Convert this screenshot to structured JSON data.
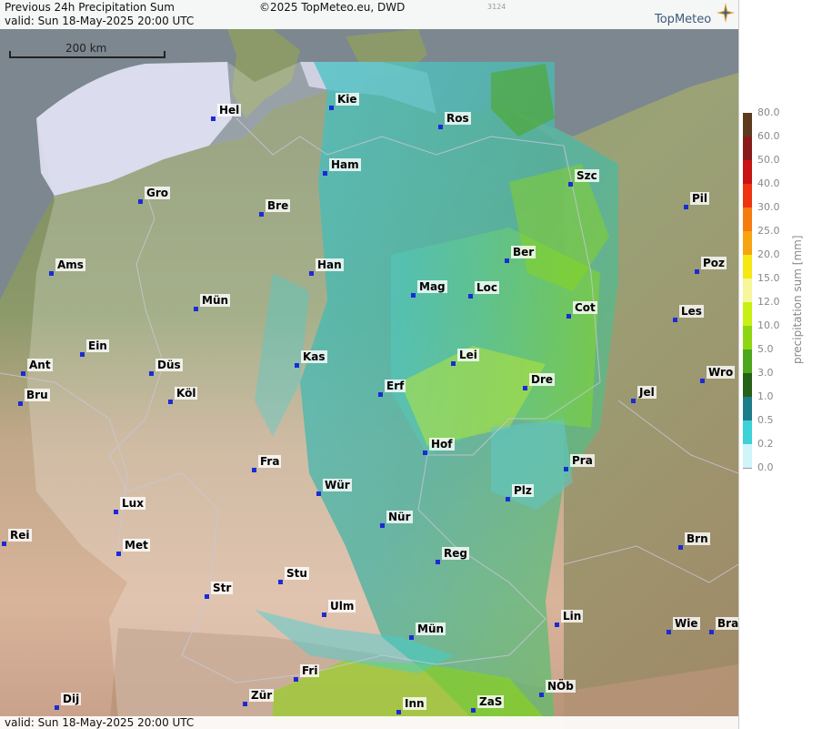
{
  "header": {
    "title": "Previous 24h Precipitation Sum",
    "valid": "valid:  Sun  18-May-2025 20:00 UTC",
    "copyright": "©2025 TopMeteo.eu, DWD",
    "code": "3124",
    "logo": "TopMeteo"
  },
  "footer": {
    "valid": "valid:  Sun  18-May-2025 20:00 UTC"
  },
  "scale_bar": {
    "label": "200 km"
  },
  "legend": {
    "title": "precipitation sum [mm]",
    "steps": [
      {
        "value": "80.0",
        "color": "#5c3a1e"
      },
      {
        "value": "60.0",
        "color": "#8a1a1a"
      },
      {
        "value": "50.0",
        "color": "#c81414"
      },
      {
        "value": "40.0",
        "color": "#ee3410"
      },
      {
        "value": "30.0",
        "color": "#f57c10"
      },
      {
        "value": "25.0",
        "color": "#f7a410"
      },
      {
        "value": "20.0",
        "color": "#f6e812"
      },
      {
        "value": "15.0",
        "color": "#f6f69a"
      },
      {
        "value": "12.0",
        "color": "#c8f012"
      },
      {
        "value": "10.0",
        "color": "#8ed612"
      },
      {
        "value": "5.0",
        "color": "#4ca81a"
      },
      {
        "value": "3.0",
        "color": "#236218"
      },
      {
        "value": "1.0",
        "color": "#1e7d8a"
      },
      {
        "value": "0.5",
        "color": "#3dd1d8"
      },
      {
        "value": "0.2",
        "color": "#cff4fa"
      },
      {
        "value": "0.0",
        "color": "#ffffff"
      }
    ]
  },
  "cities": [
    {
      "name": "Hel",
      "id": "hel"
    },
    {
      "name": "Kie",
      "id": "kie"
    },
    {
      "name": "Ros",
      "id": "ros"
    },
    {
      "name": "Ham",
      "id": "ham"
    },
    {
      "name": "Szc",
      "id": "szc"
    },
    {
      "name": "Gro",
      "id": "gro"
    },
    {
      "name": "Bre",
      "id": "bre"
    },
    {
      "name": "Pil",
      "id": "pil"
    },
    {
      "name": "Ber",
      "id": "ber"
    },
    {
      "name": "Ams",
      "id": "ams"
    },
    {
      "name": "Han",
      "id": "han"
    },
    {
      "name": "Poz",
      "id": "poz"
    },
    {
      "name": "Mag",
      "id": "mag"
    },
    {
      "name": "Loc",
      "id": "loc"
    },
    {
      "name": "Mün",
      "id": "mun-w"
    },
    {
      "name": "Cot",
      "id": "cot"
    },
    {
      "name": "Les",
      "id": "les"
    },
    {
      "name": "Ein",
      "id": "ein"
    },
    {
      "name": "Kas",
      "id": "kas"
    },
    {
      "name": "Lei",
      "id": "lei"
    },
    {
      "name": "Ant",
      "id": "ant"
    },
    {
      "name": "Düs",
      "id": "dus"
    },
    {
      "name": "Dre",
      "id": "dre"
    },
    {
      "name": "Wro",
      "id": "wro"
    },
    {
      "name": "Erf",
      "id": "erf"
    },
    {
      "name": "Jel",
      "id": "jel"
    },
    {
      "name": "Bru",
      "id": "bru"
    },
    {
      "name": "Köl",
      "id": "kol"
    },
    {
      "name": "Hof",
      "id": "hof"
    },
    {
      "name": "Fra",
      "id": "fra"
    },
    {
      "name": "Pra",
      "id": "pra"
    },
    {
      "name": "Wür",
      "id": "wur"
    },
    {
      "name": "Plz",
      "id": "plz"
    },
    {
      "name": "Lux",
      "id": "lux"
    },
    {
      "name": "Nür",
      "id": "nur"
    },
    {
      "name": "Rei",
      "id": "rei"
    },
    {
      "name": "Met",
      "id": "met"
    },
    {
      "name": "Reg",
      "id": "reg"
    },
    {
      "name": "Brn",
      "id": "brn"
    },
    {
      "name": "Str",
      "id": "str"
    },
    {
      "name": "Stu",
      "id": "stu"
    },
    {
      "name": "Ulm",
      "id": "ulm"
    },
    {
      "name": "Lin",
      "id": "lin"
    },
    {
      "name": "Mün",
      "id": "mun-s"
    },
    {
      "name": "Wie",
      "id": "wie"
    },
    {
      "name": "Bra",
      "id": "bra"
    },
    {
      "name": "Fri",
      "id": "fri"
    },
    {
      "name": "NÖb",
      "id": "nob"
    },
    {
      "name": "Dij",
      "id": "dij"
    },
    {
      "name": "Zür",
      "id": "zur"
    },
    {
      "name": "Inn",
      "id": "inn"
    },
    {
      "name": "ZaS",
      "id": "zas"
    }
  ]
}
